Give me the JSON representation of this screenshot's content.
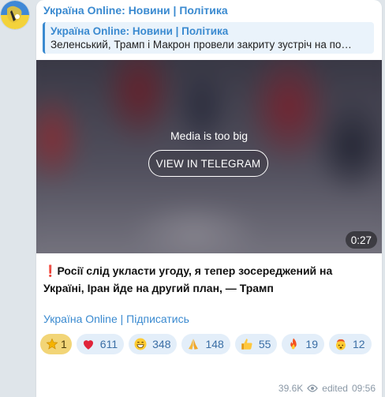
{
  "channel": {
    "name": "Україна Online: Новини | Політика"
  },
  "reply": {
    "title": "Україна Online: Новини | Політика",
    "text": "Зеленський, Трамп і Макрон провели закриту зустріч на по…"
  },
  "media": {
    "notice": "Media is too big",
    "button_label": "VIEW IN TELEGRAM",
    "duration": "0:27"
  },
  "post": {
    "text": "Росії слід укласти угоду, я тепер зосереджений на Україні, Іран йде на другий план, — Трамп",
    "subscribe_link": "Україна Online | Підписатись"
  },
  "reactions": [
    {
      "icon": "star-icon",
      "count": "1"
    },
    {
      "icon": "red-heart-icon",
      "count": "611"
    },
    {
      "icon": "grinning-face-icon",
      "count": "348"
    },
    {
      "icon": "folded-hands-icon",
      "count": "148"
    },
    {
      "icon": "thumbs-up-icon",
      "count": "55"
    },
    {
      "icon": "fire-icon",
      "count": "19"
    },
    {
      "icon": "exploding-head-icon",
      "count": "12"
    }
  ],
  "footer": {
    "views": "39.6K",
    "edited_label": "edited",
    "time": "09:56"
  },
  "colors": {
    "accent": "#3a8ad0",
    "reaction_bg": "#e3eef9",
    "star_bg": "#f2d577",
    "background": "#dfe5ea"
  }
}
